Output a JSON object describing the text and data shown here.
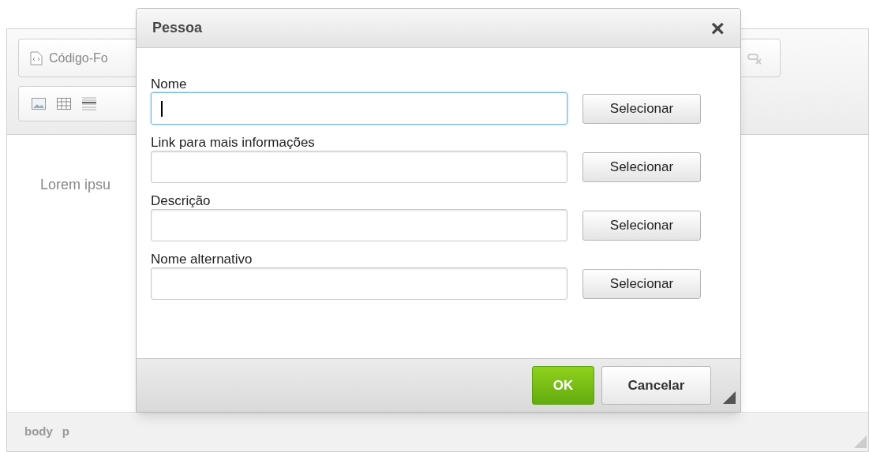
{
  "editor": {
    "toolbar": {
      "source_button": "Código-Fo"
    },
    "content": "Lorem ipsu",
    "status_bar": {
      "path": [
        "body",
        "p"
      ]
    }
  },
  "dialog": {
    "title": "Pessoa",
    "close": "×",
    "fields": [
      {
        "label": "Nome",
        "button": "Selecionar",
        "focused": true
      },
      {
        "label": "Link para mais informações",
        "button": "Selecionar",
        "focused": false
      },
      {
        "label": "Descrição",
        "button": "Selecionar",
        "focused": false
      },
      {
        "label": "Nome alternativo",
        "button": "Selecionar",
        "focused": false
      }
    ],
    "buttons": [
      {
        "label": "OK",
        "kind": "primary"
      },
      {
        "label": "Cancelar",
        "kind": "secondary"
      }
    ]
  }
}
